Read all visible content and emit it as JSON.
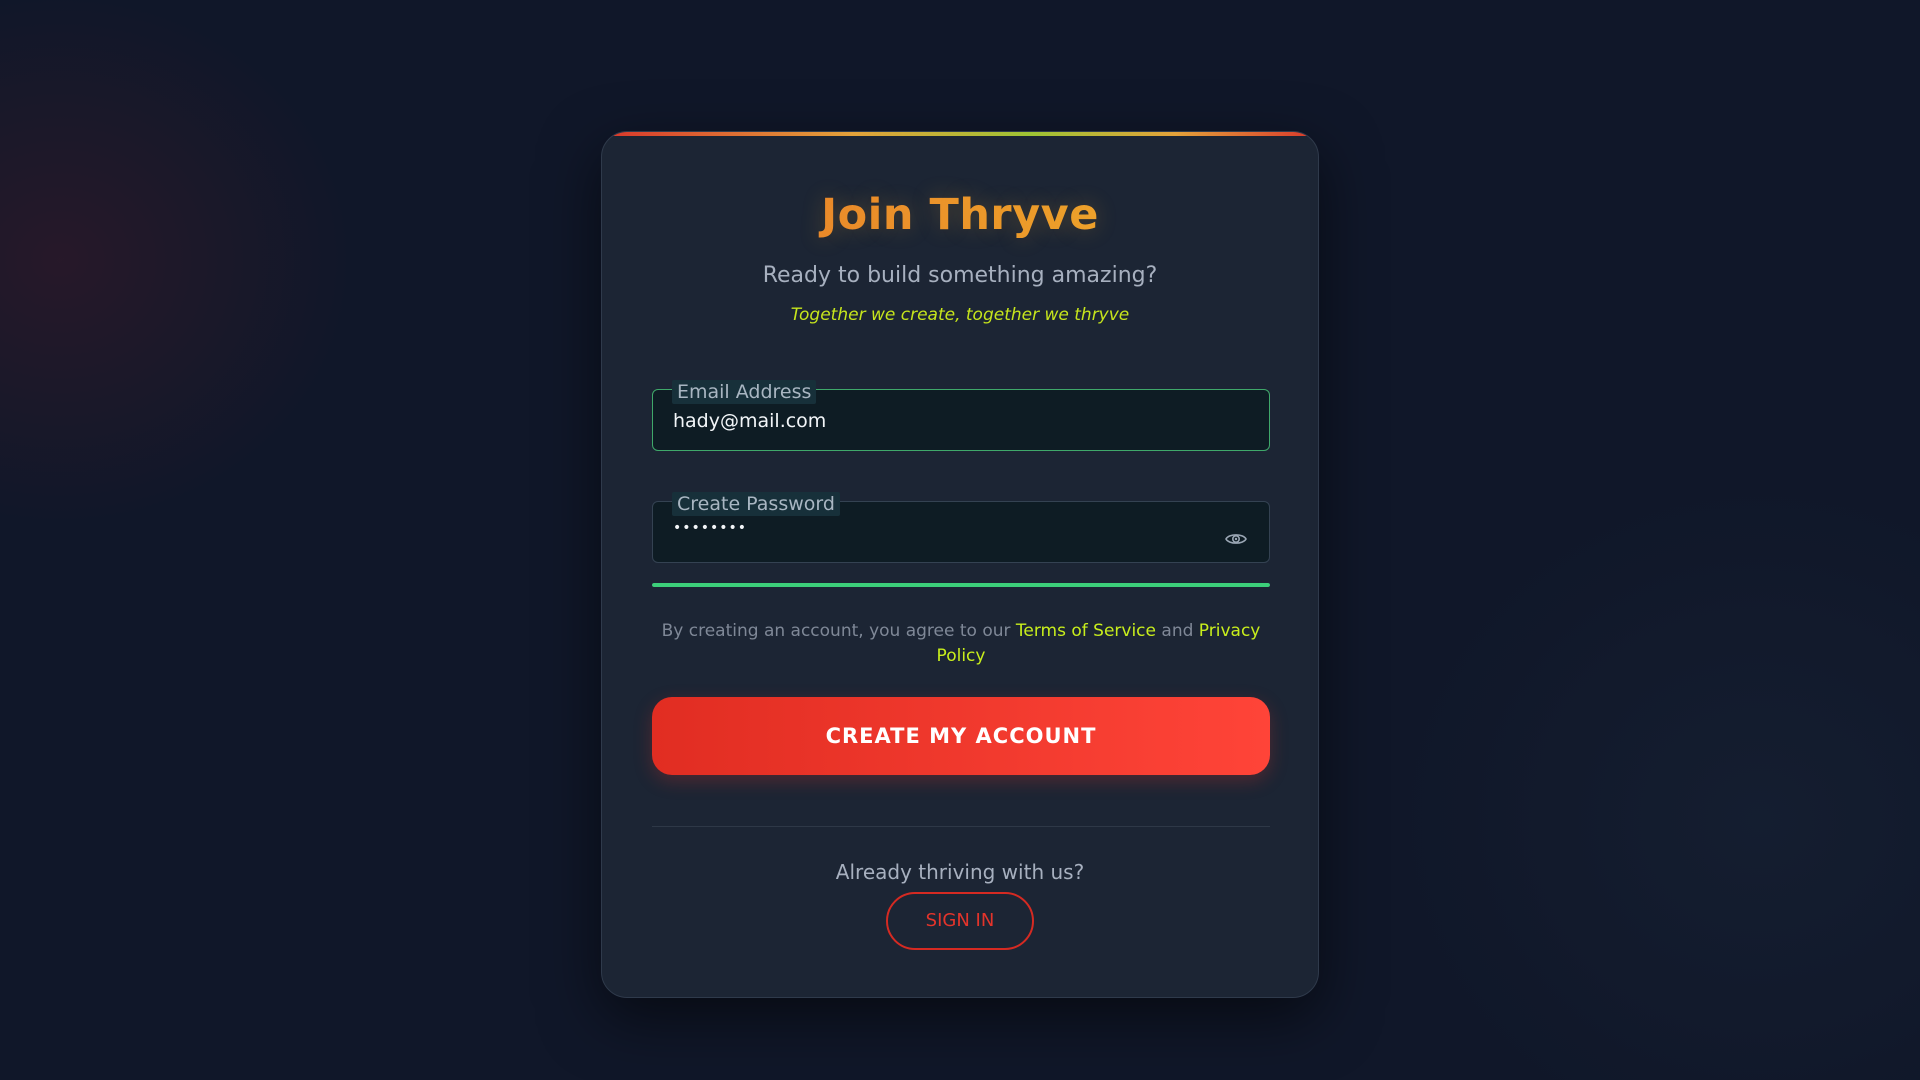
{
  "signup": {
    "title": "Join Thryve",
    "subtitle": "Ready to build something amazing?",
    "tagline": "Together we create, together we thryve",
    "email": {
      "label": "Email Address",
      "value": "hady@mail.com"
    },
    "password": {
      "label": "Create Password",
      "value": "••••••••",
      "toggle_icon": "eye-icon",
      "strength_fraction": 1.0
    },
    "terms": {
      "prefix": "By creating an account, you agree to our ",
      "tos_link": "Terms of Service",
      "conjunction": " and ",
      "privacy_link": "Privacy Policy"
    },
    "create_button": "CREATE MY ACCOUNT",
    "already_text": "Already thriving with us?",
    "signin_button": "SIGN IN"
  },
  "colors": {
    "background": "#101729",
    "card": "#1c2534",
    "title_gradient_start": "#e8762a",
    "title_gradient_end": "#f0b42c",
    "accent_lime": "#c8ee1c",
    "strength_green": "#3ccf7a",
    "primary_red": "#e12d22"
  }
}
